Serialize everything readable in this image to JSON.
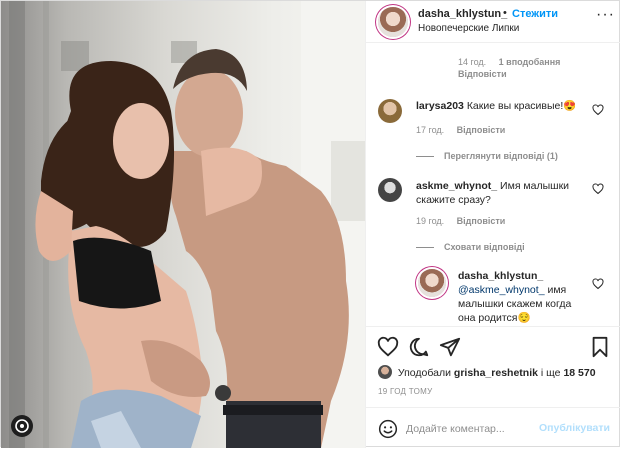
{
  "header": {
    "username": "dasha_khlystun_",
    "separator": "•",
    "follow_label": "Стежити",
    "location": "Новопечерские Липки",
    "more_icon": "more-options-icon"
  },
  "top_meta": {
    "time": "14 год.",
    "likes": "1 вподобання",
    "reply": "Відповісти"
  },
  "comments": [
    {
      "username": "larysa203",
      "text": "Какие вы красивые!😍",
      "time": "17 год.",
      "reply": "Відповісти",
      "view_replies": "Переглянути відповіді (1)"
    },
    {
      "username": "askme_whynot_",
      "text_line1": "Имя малышки",
      "text_line2": "скажите сразу?",
      "time": "19 год.",
      "reply": "Відповісти",
      "hide_replies": "Сховати відповіді"
    }
  ],
  "reply": {
    "username": "dasha_khlystun_",
    "mention": "@askme_whynot_",
    "text_line1": "имя",
    "text_line2": "малышки скажем когда",
    "text_line3": "она родится😌"
  },
  "actions": {
    "icons": [
      "heart-icon",
      "comment-icon",
      "share-icon",
      "bookmark-icon"
    ],
    "liked_by_prefix": "Уподобали",
    "liked_by_user": "grisha_reshetnik",
    "liked_by_and": "і ще",
    "liked_by_count": "18 570",
    "time": "19 ГОД ТОМУ",
    "comment_placeholder": "Додайте коментар...",
    "publish_label": "Опублікувати"
  },
  "colors": {
    "accent": "#0095f6",
    "publish_disabled": "#b2dffc",
    "muted": "#8e8e8e",
    "text": "#262626"
  }
}
